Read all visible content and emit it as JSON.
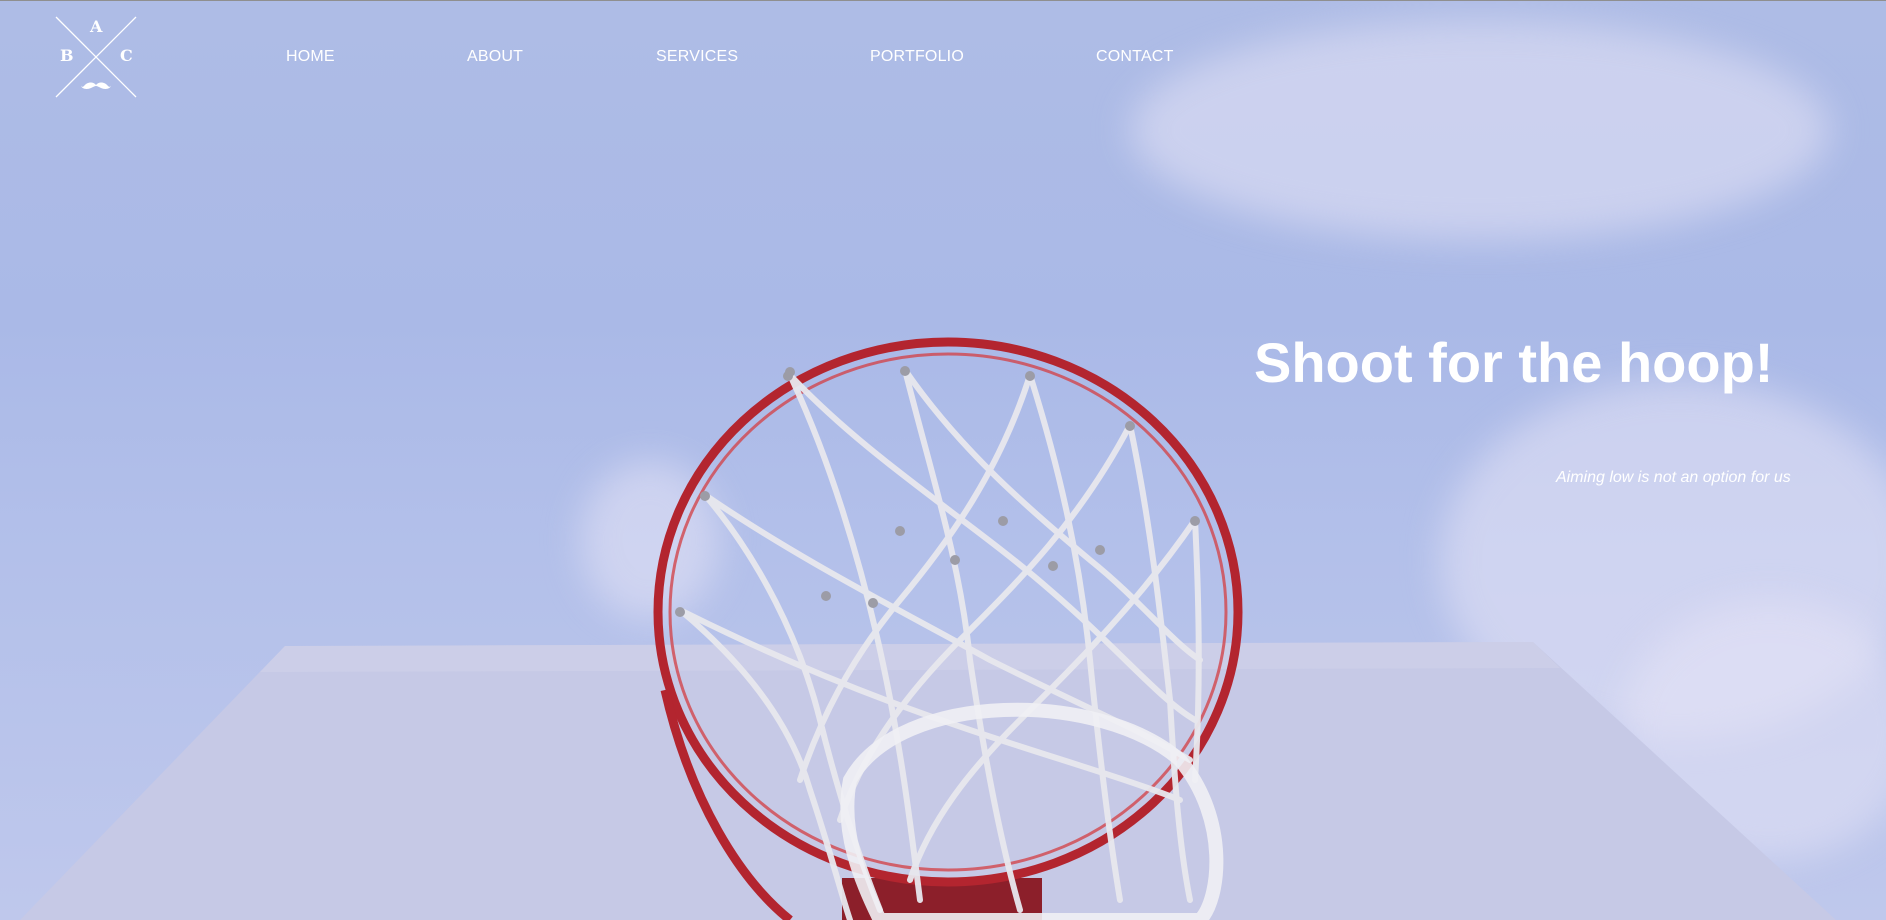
{
  "brand": {
    "logo_letters": [
      "A",
      "B",
      "C"
    ],
    "logo_icon": "mustache-icon"
  },
  "nav": {
    "items": [
      {
        "label": "HOME"
      },
      {
        "label": "ABOUT"
      },
      {
        "label": "SERVICES"
      },
      {
        "label": "PORTFOLIO"
      },
      {
        "label": "CONTACT"
      }
    ]
  },
  "hero": {
    "headline": "Shoot for the hoop!",
    "tagline": "Aiming low is not an option for us",
    "background_subject": "basketball hoop against blue sky",
    "colors": {
      "sky": "#aebce6",
      "rim": "#b8242f",
      "net": "#e9e9ee",
      "backboard": "#c8cbe6",
      "text": "#ffffff"
    }
  }
}
